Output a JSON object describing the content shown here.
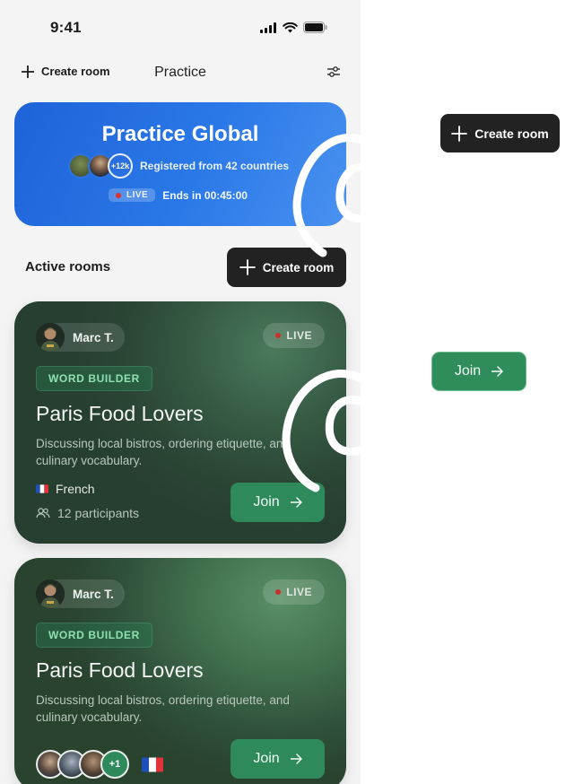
{
  "status_bar": {
    "time": "9:41",
    "icons": [
      "signal-icon",
      "wifi-icon",
      "battery-icon"
    ]
  },
  "nav": {
    "create_label": "Create room",
    "title": "Practice",
    "filter_icon": "sliders-icon"
  },
  "hero": {
    "title": "Practice Global",
    "avatar_count": "+12k",
    "registered_text": "Registered from 42 countries",
    "live_label": "LIVE",
    "ends_text": "Ends in 00:45:00"
  },
  "section": {
    "title": "Active rooms",
    "create_label": "Create room"
  },
  "rooms": [
    {
      "host": "Marc T.",
      "live_label": "LIVE",
      "tag": "WORD BUILDER",
      "title": "Paris Food Lovers",
      "description": "Discussing local bistros, ordering etiquette, and culinary vocabulary.",
      "language": "French",
      "participants": "12 participants",
      "join_label": "Join"
    },
    {
      "host": "Marc T.",
      "live_label": "LIVE",
      "tag": "WORD BUILDER",
      "title": "Paris Food Lovers",
      "description": "Discussing local bistros, ordering etiquette, and culinary vocabulary.",
      "extra_participants": "+1",
      "join_label": "Join"
    }
  ],
  "components": {
    "create_label": "Create room",
    "join_label": "Join"
  },
  "colors": {
    "hero_blue": "#2a72e4",
    "card_green": "#2f5039",
    "join_green": "#2e8a5a",
    "dark_button": "#222222",
    "live_red": "#e0322f",
    "tag_text": "#8fe0b0"
  }
}
